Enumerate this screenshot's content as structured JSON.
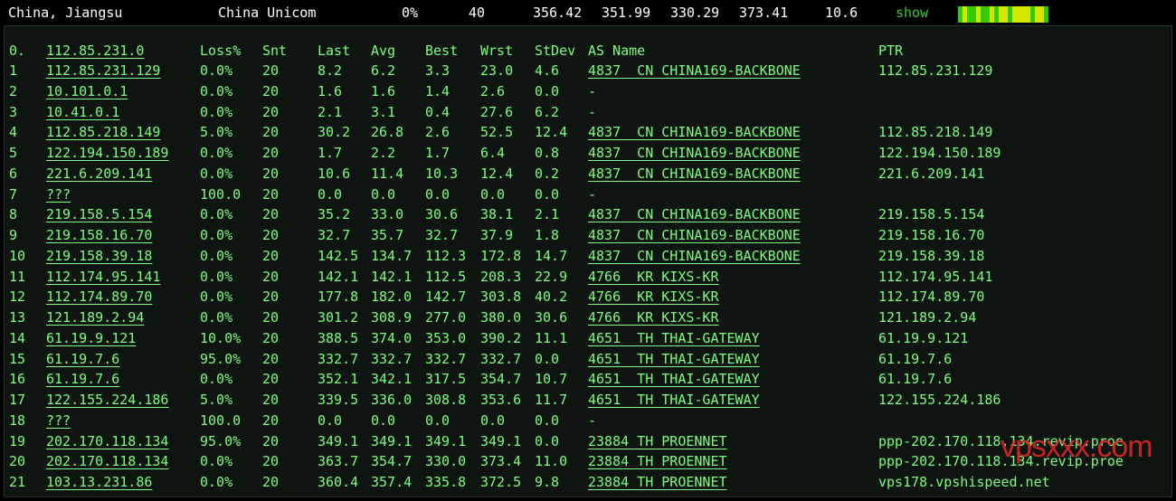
{
  "topbar": {
    "location": "China, Jiangsu",
    "isp": "China Unicom",
    "loss": "0%",
    "sent": "40",
    "last": "356.42",
    "avg": "351.99",
    "best": "330.29",
    "worst": "373.41",
    "stdev": "10.6",
    "show_label": "show",
    "bar_colors": [
      "#33cc00",
      "#d4e600",
      "#33cc00",
      "#33cc00",
      "#d4e600",
      "#33cc00",
      "#33cc00",
      "#d4e600",
      "#33cc00",
      "#d4e600",
      "#d4e600",
      "#33cc00",
      "#d4e600",
      "#d4e600",
      "#d4e600",
      "#d4e600",
      "#33cc00",
      "#d4e600",
      "#d4e600",
      "#33cc00"
    ]
  },
  "table": {
    "headers": {
      "no": "0.",
      "host": "112.85.231.0",
      "loss": "Loss%",
      "snt": "Snt",
      "last": "Last",
      "avg": "Avg",
      "best": "Best",
      "wrst": "Wrst",
      "stdev": "StDev",
      "as_name": "AS Name",
      "ptr": "PTR"
    },
    "rows": [
      {
        "no": "1",
        "host": "112.85.231.129",
        "loss": "0.0%",
        "snt": "20",
        "last": "8.2",
        "avg": "6.2",
        "best": "3.3",
        "wrst": "23.0",
        "stdev": "4.6",
        "as_name": "4837  CN CHINA169-BACKBONE",
        "ptr": "112.85.231.129"
      },
      {
        "no": "2",
        "host": "10.101.0.1",
        "loss": "0.0%",
        "snt": "20",
        "last": "1.6",
        "avg": "1.6",
        "best": "1.4",
        "wrst": "2.6",
        "stdev": "0.0",
        "as_name": "-",
        "ptr": ""
      },
      {
        "no": "3",
        "host": "10.41.0.1",
        "loss": "0.0%",
        "snt": "20",
        "last": "2.1",
        "avg": "3.1",
        "best": "0.4",
        "wrst": "27.6",
        "stdev": "6.2",
        "as_name": "-",
        "ptr": ""
      },
      {
        "no": "4",
        "host": "112.85.218.149",
        "loss": "5.0%",
        "snt": "20",
        "last": "30.2",
        "avg": "26.8",
        "best": "2.6",
        "wrst": "52.5",
        "stdev": "12.4",
        "as_name": "4837  CN CHINA169-BACKBONE",
        "ptr": "112.85.218.149"
      },
      {
        "no": "5",
        "host": "122.194.150.189",
        "loss": "0.0%",
        "snt": "20",
        "last": "1.7",
        "avg": "2.2",
        "best": "1.7",
        "wrst": "6.4",
        "stdev": "0.8",
        "as_name": "4837  CN CHINA169-BACKBONE",
        "ptr": "122.194.150.189"
      },
      {
        "no": "6",
        "host": "221.6.209.141",
        "loss": "0.0%",
        "snt": "20",
        "last": "10.6",
        "avg": "11.4",
        "best": "10.3",
        "wrst": "12.4",
        "stdev": "0.2",
        "as_name": "4837  CN CHINA169-BACKBONE",
        "ptr": "221.6.209.141"
      },
      {
        "no": "7",
        "host": "???",
        "loss": "100.0",
        "snt": "20",
        "last": "0.0",
        "avg": "0.0",
        "best": "0.0",
        "wrst": "0.0",
        "stdev": "0.0",
        "as_name": "-",
        "ptr": ""
      },
      {
        "no": "8",
        "host": "219.158.5.154",
        "loss": "0.0%",
        "snt": "20",
        "last": "35.2",
        "avg": "33.0",
        "best": "30.6",
        "wrst": "38.1",
        "stdev": "2.1",
        "as_name": "4837  CN CHINA169-BACKBONE",
        "ptr": "219.158.5.154"
      },
      {
        "no": "9",
        "host": "219.158.16.70",
        "loss": "0.0%",
        "snt": "20",
        "last": "32.7",
        "avg": "35.7",
        "best": "32.7",
        "wrst": "37.9",
        "stdev": "1.8",
        "as_name": "4837  CN CHINA169-BACKBONE",
        "ptr": "219.158.16.70"
      },
      {
        "no": "10",
        "host": "219.158.39.18",
        "loss": "0.0%",
        "snt": "20",
        "last": "142.5",
        "avg": "134.7",
        "best": "112.3",
        "wrst": "172.8",
        "stdev": "14.7",
        "as_name": "4837  CN CHINA169-BACKBONE",
        "ptr": "219.158.39.18"
      },
      {
        "no": "11",
        "host": "112.174.95.141",
        "loss": "0.0%",
        "snt": "20",
        "last": "142.1",
        "avg": "142.1",
        "best": "112.5",
        "wrst": "208.3",
        "stdev": "22.9",
        "as_name": "4766  KR KIXS-KR",
        "ptr": "112.174.95.141"
      },
      {
        "no": "12",
        "host": "112.174.89.70",
        "loss": "0.0%",
        "snt": "20",
        "last": "177.8",
        "avg": "182.0",
        "best": "142.7",
        "wrst": "303.8",
        "stdev": "40.2",
        "as_name": "4766  KR KIXS-KR",
        "ptr": "112.174.89.70"
      },
      {
        "no": "13",
        "host": "121.189.2.94",
        "loss": "0.0%",
        "snt": "20",
        "last": "301.2",
        "avg": "308.9",
        "best": "277.0",
        "wrst": "380.0",
        "stdev": "30.6",
        "as_name": "4766  KR KIXS-KR",
        "ptr": "121.189.2.94"
      },
      {
        "no": "14",
        "host": "61.19.9.121",
        "loss": "10.0%",
        "snt": "20",
        "last": "388.5",
        "avg": "374.0",
        "best": "353.0",
        "wrst": "390.2",
        "stdev": "11.1",
        "as_name": "4651  TH THAI-GATEWAY",
        "ptr": "61.19.9.121"
      },
      {
        "no": "15",
        "host": "61.19.7.6",
        "loss": "95.0%",
        "snt": "20",
        "last": "332.7",
        "avg": "332.7",
        "best": "332.7",
        "wrst": "332.7",
        "stdev": "0.0",
        "as_name": "4651  TH THAI-GATEWAY",
        "ptr": "61.19.7.6"
      },
      {
        "no": "16",
        "host": "61.19.7.6",
        "loss": "0.0%",
        "snt": "20",
        "last": "352.1",
        "avg": "342.1",
        "best": "317.5",
        "wrst": "354.7",
        "stdev": "10.7",
        "as_name": "4651  TH THAI-GATEWAY",
        "ptr": "61.19.7.6"
      },
      {
        "no": "17",
        "host": "122.155.224.186",
        "loss": "5.0%",
        "snt": "20",
        "last": "339.5",
        "avg": "336.0",
        "best": "308.8",
        "wrst": "353.6",
        "stdev": "11.7",
        "as_name": "4651  TH THAI-GATEWAY",
        "ptr": "122.155.224.186"
      },
      {
        "no": "18",
        "host": "???",
        "loss": "100.0",
        "snt": "20",
        "last": "0.0",
        "avg": "0.0",
        "best": "0.0",
        "wrst": "0.0",
        "stdev": "0.0",
        "as_name": "-",
        "ptr": ""
      },
      {
        "no": "19",
        "host": "202.170.118.134",
        "loss": "95.0%",
        "snt": "20",
        "last": "349.1",
        "avg": "349.1",
        "best": "349.1",
        "wrst": "349.1",
        "stdev": "0.0",
        "as_name": "23884 TH PROENNET",
        "ptr": "ppp-202.170.118.134.revip.proe"
      },
      {
        "no": "20",
        "host": "202.170.118.134",
        "loss": "0.0%",
        "snt": "20",
        "last": "363.7",
        "avg": "354.7",
        "best": "330.0",
        "wrst": "373.4",
        "stdev": "11.0",
        "as_name": "23884 TH PROENNET",
        "ptr": "ppp-202.170.118.134.revip.proe"
      },
      {
        "no": "21",
        "host": "103.13.231.86",
        "loss": "0.0%",
        "snt": "20",
        "last": "360.4",
        "avg": "357.4",
        "best": "335.8",
        "wrst": "372.5",
        "stdev": "9.8",
        "as_name": "23884 TH PROENNET",
        "ptr": "vps178.vpshispeed.net"
      }
    ]
  },
  "watermark": "vpsxxx.com"
}
